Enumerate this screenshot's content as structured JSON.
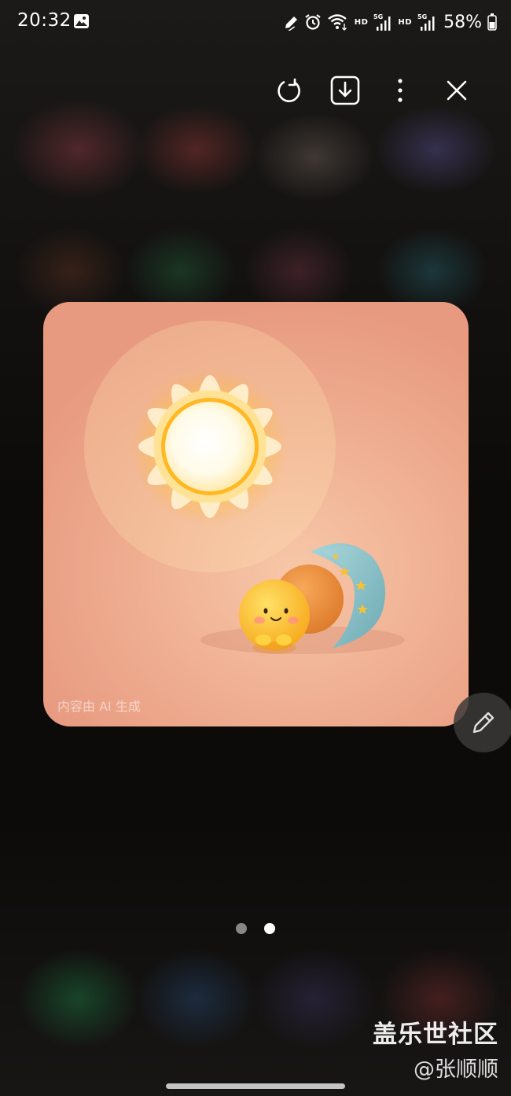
{
  "status_bar": {
    "time": "20:32",
    "icons": [
      "gallery-icon",
      "pen-icon",
      "alarm-icon",
      "wifi-icon",
      "hd-badge",
      "signal-5g-icon",
      "hd-badge",
      "signal-5g-icon",
      "battery-icon"
    ],
    "hd_label": "HD",
    "network_label": "5G",
    "battery": "58%"
  },
  "toolbar": {
    "buttons": [
      "rotate-icon",
      "download-icon",
      "more-icon",
      "close-icon"
    ]
  },
  "image": {
    "watermark": "内容由 AI 生成",
    "colors": {
      "background": "#efad90",
      "sun_glow": "#ffd24a",
      "moon": "#8ec4c8",
      "orange_ball": "#f0923a",
      "yellow_ball": "#ffc42c"
    }
  },
  "pager": {
    "count": 2,
    "active_index": 1
  },
  "watermark": {
    "forum": "盖乐世社区",
    "user": "@张顺顺"
  }
}
